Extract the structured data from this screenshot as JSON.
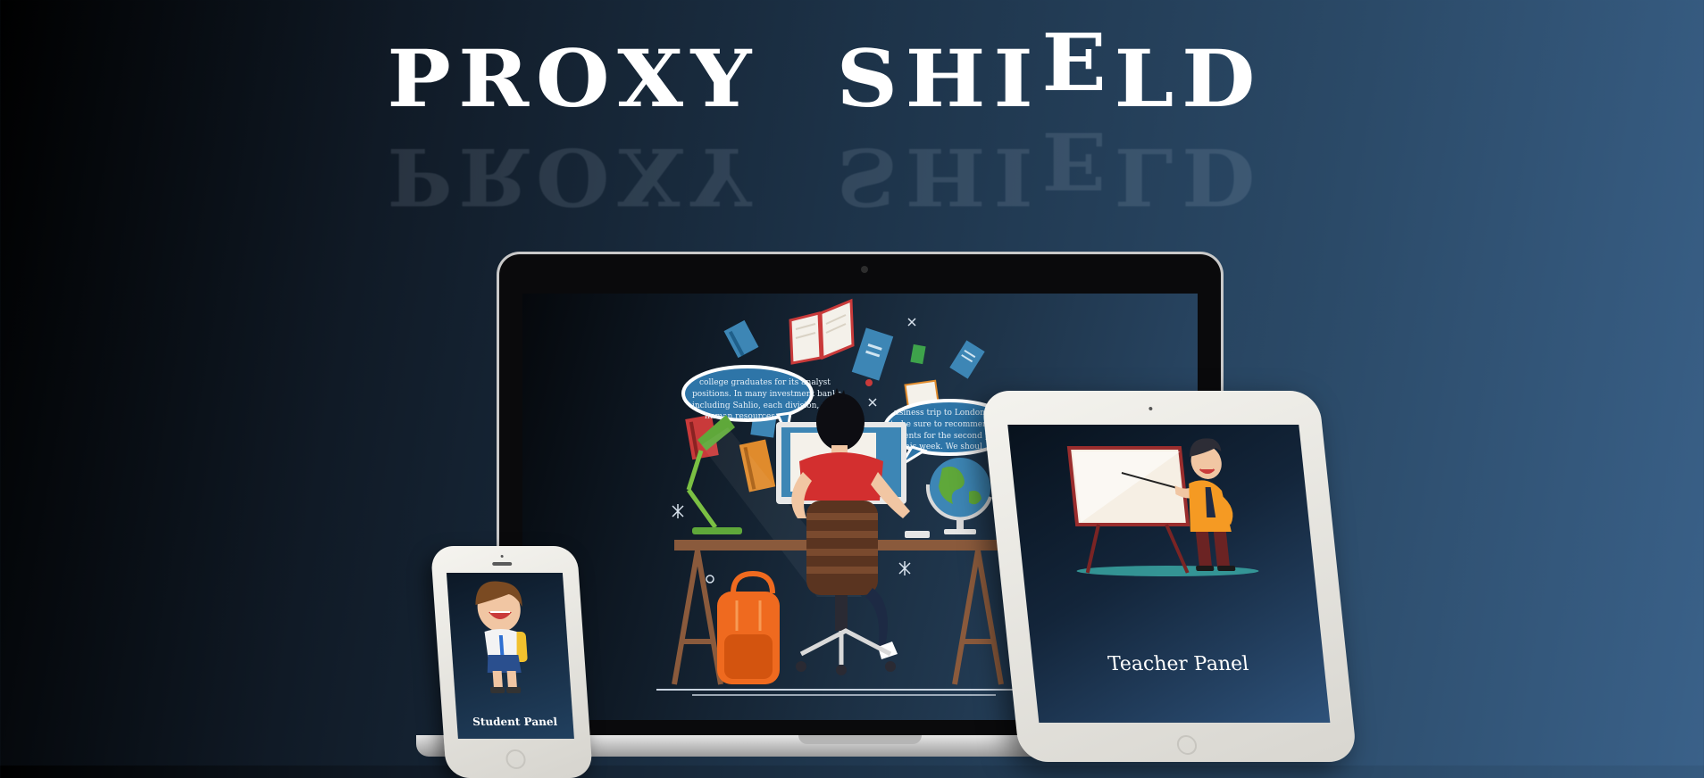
{
  "title": {
    "word1": [
      "P",
      "R",
      "O",
      "X",
      "Y"
    ],
    "word2": [
      "S",
      "H",
      "I",
      "E",
      "L",
      "D"
    ]
  },
  "illustration": {
    "bubble_left": [
      "college graduates for its analyst",
      "positions. In many investment banks",
      "including Sahlio, each division, no",
      "human resources"
    ],
    "bubble_right": [
      "usiness trip to London next week",
      "to be sure to recommend at least fiv",
      "tudents for the second phase by th",
      "his week. We shoul"
    ]
  },
  "panels": {
    "teacher_label": "Teacher Panel",
    "student_label": "Student Panel"
  },
  "colors": {
    "background_dark": "#000000",
    "background_light": "#3a6189",
    "title": "#ffffff",
    "shirt_red": "#d32f2f",
    "backpack_orange": "#ef6a1f",
    "teacher_shirt": "#f59a23"
  },
  "icons": [
    "desk-lamp-icon",
    "globe-icon",
    "backpack-icon",
    "office-chair-icon",
    "book-icon",
    "presentation-board-icon"
  ]
}
